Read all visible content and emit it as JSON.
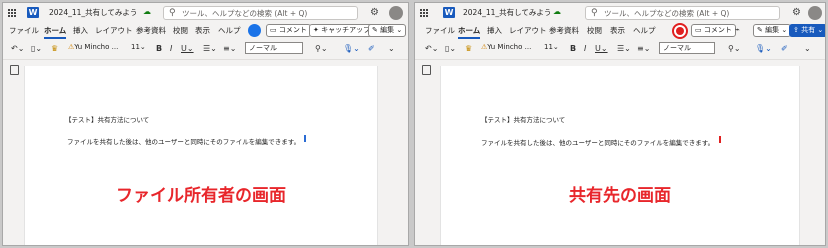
{
  "panes": [
    {
      "id": "owner",
      "document_title": "2024_11_共有してみよう",
      "search_placeholder": "ツール、ヘルプなどの検索 (Alt + Q)",
      "tabs": [
        "ファイル",
        "ホーム",
        "挿入",
        "レイアウト",
        "参考資料",
        "校閲",
        "表示",
        "ヘルプ"
      ],
      "active_tab": "ホーム",
      "buttons": {
        "comment": "コメント",
        "catchup": "キャッチアップ",
        "edit": "編集"
      },
      "toolbar": {
        "font": "Yu Mincho ...",
        "font_size": "11",
        "style": "ノーマル"
      },
      "doc_heading": "【テスト】共有方法について",
      "doc_body": "ファイルを共有した後は、他のユーザーと同時にそのファイルを編集できます。",
      "cursor_color": "#2b6cd4",
      "avatar_ring_color": "#1a73e8",
      "caption": "ファイル所有者の画面"
    },
    {
      "id": "collaborator",
      "document_title": "2024_11_共有してみよう",
      "search_placeholder": "ツール、ヘルプなどの検索 (Alt + Q)",
      "tabs": [
        "ファイル",
        "ホーム",
        "挿入",
        "レイアウト",
        "参考資料",
        "校閲",
        "表示",
        "ヘルプ"
      ],
      "active_tab": "ホーム",
      "buttons": {
        "comment": "コメント",
        "edit": "編集",
        "share": "共有"
      },
      "toolbar": {
        "font": "Yu Mincho ...",
        "font_size": "11",
        "style": "ノーマル"
      },
      "doc_heading": "【テスト】共有方法について",
      "doc_body": "ファイルを共有した後は、他のユーザーと同時にそのファイルを編集できます。",
      "cursor_color": "#e02020",
      "avatar_ring_color": "#e02020",
      "caption": "共有先の画面"
    }
  ],
  "icons": [
    "apps-grid-icon",
    "word-icon",
    "cloud-saved-icon",
    "search-icon",
    "gear-icon",
    "undo-icon",
    "paste-icon",
    "format-painter-icon",
    "bold-icon",
    "italic-icon",
    "bullets-icon",
    "align-icon",
    "find-icon",
    "dictate-icon",
    "pane-toggle-icon"
  ],
  "colors": {
    "word_blue": "#185abd",
    "caption_red": "#e8262b"
  }
}
